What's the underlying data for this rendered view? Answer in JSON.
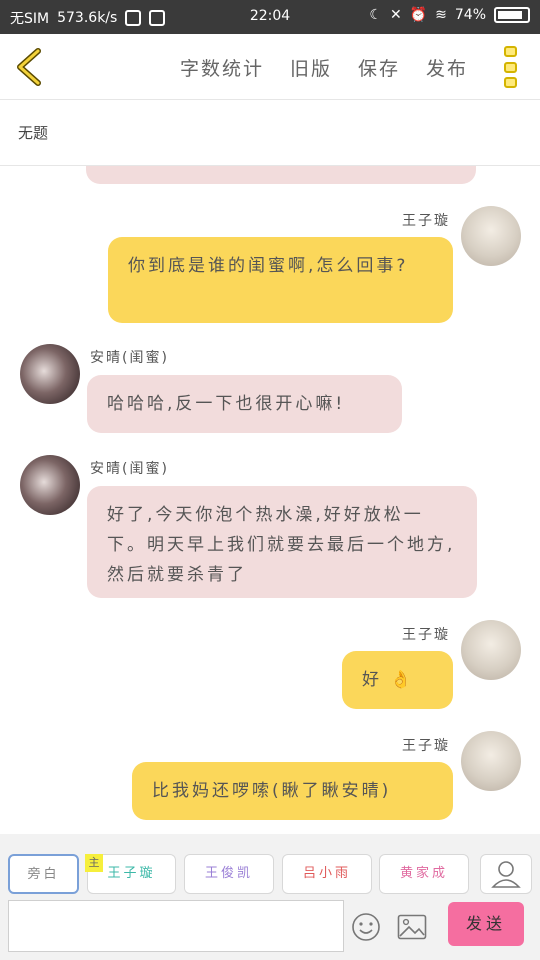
{
  "status_bar": {
    "carrier": "无SIM",
    "speed": "573.6k/s",
    "time": "22:04",
    "battery": "74%"
  },
  "header": {
    "actions": [
      "字数统计",
      "旧版",
      "保存",
      "发布"
    ]
  },
  "doc": {
    "title": "无题"
  },
  "messages": [
    {
      "side": "left",
      "text": ""
    },
    {
      "side": "right",
      "name": "王子璇",
      "text": "你到底是谁的闺蜜啊,怎么回事?"
    },
    {
      "side": "left",
      "name": "安晴(闺蜜)",
      "text": "哈哈哈,反一下也很开心嘛!"
    },
    {
      "side": "left",
      "name": "安晴(闺蜜)",
      "text": "好了,今天你泡个热水澡,好好放松一下。明天早上我们就要去最后一个地方,然后就要杀青了"
    },
    {
      "side": "right",
      "name": "王子璇",
      "text": "好",
      "emoji": "👌"
    },
    {
      "side": "right",
      "name": "王子璇",
      "text": "比我妈还啰嗦(瞅了瞅安晴)"
    }
  ],
  "footer": {
    "roles": [
      {
        "label": "旁白",
        "color": "#888888"
      },
      {
        "label": "王子璇",
        "color": "#3cb8a8"
      },
      {
        "label": "王俊凯",
        "color": "#9a7fd6"
      },
      {
        "label": "吕小雨",
        "color": "#e05a5a"
      },
      {
        "label": "黄家成",
        "color": "#e06aa0"
      }
    ],
    "main_tag": "主",
    "input_value": "",
    "send_label": "发送"
  },
  "colors": {
    "accent_yellow": "#fbd75a",
    "bubble_pink": "#f2dcdc",
    "send_pink": "#f56ea0"
  }
}
